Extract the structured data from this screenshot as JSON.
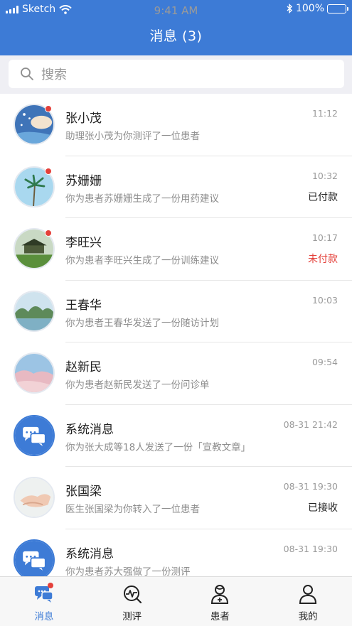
{
  "status_bar": {
    "carrier": "Sketch",
    "time": "9:41 AM",
    "battery": "100%"
  },
  "header": {
    "title": "消息 (3)"
  },
  "search": {
    "placeholder": "搜索"
  },
  "messages": [
    {
      "name": "张小茂",
      "preview": "助理张小茂为你测评了一位患者",
      "time": "11:12",
      "status": "",
      "unread": true,
      "avatar": "avatar-photo"
    },
    {
      "name": "苏姗姗",
      "preview": "你为患者苏姗姗生成了一份用药建议",
      "time": "10:32",
      "status": "已付款",
      "unread": true,
      "avatar": "avatar-photo"
    },
    {
      "name": "李旺兴",
      "preview": "你为患者李旺兴生成了一份训练建议",
      "time": "10:17",
      "status": "未付款",
      "unread": true,
      "avatar": "avatar-photo"
    },
    {
      "name": "王春华",
      "preview": "你为患者王春华发送了一份随访计划",
      "time": "10:03",
      "status": "",
      "unread": false,
      "avatar": "avatar-photo"
    },
    {
      "name": "赵新民",
      "preview": "你为患者赵新民发送了一份问诊单",
      "time": "09:54",
      "status": "",
      "unread": false,
      "avatar": "avatar-photo"
    },
    {
      "name": "系统消息",
      "preview": "你为张大成等18人发送了一份「宣教文章」",
      "time": "08-31 21:42",
      "status": "",
      "unread": false,
      "avatar": "chat-bubbles-icon"
    },
    {
      "name": "张国梁",
      "preview": "医生张国梁为你转入了一位患者",
      "time": "08-31 19:30",
      "status": "已接收",
      "unread": false,
      "avatar": "avatar-photo"
    },
    {
      "name": "系统消息",
      "preview": "你为患者苏大强做了一份测评",
      "time": "08-31 19:30",
      "status": "",
      "unread": false,
      "avatar": "chat-bubbles-icon"
    }
  ],
  "tabs": [
    {
      "label": "消息",
      "icon": "chat-icon",
      "active": true,
      "badge": true
    },
    {
      "label": "测评",
      "icon": "assessment-icon",
      "active": false,
      "badge": false
    },
    {
      "label": "患者",
      "icon": "patient-icon",
      "active": false,
      "badge": false
    },
    {
      "label": "我的",
      "icon": "profile-icon",
      "active": false,
      "badge": false
    }
  ],
  "colors": {
    "primary": "#3d7bd6",
    "unread_dot": "#e4403a",
    "unpaid": "#e4403a",
    "muted_text": "#8e8e8e"
  }
}
